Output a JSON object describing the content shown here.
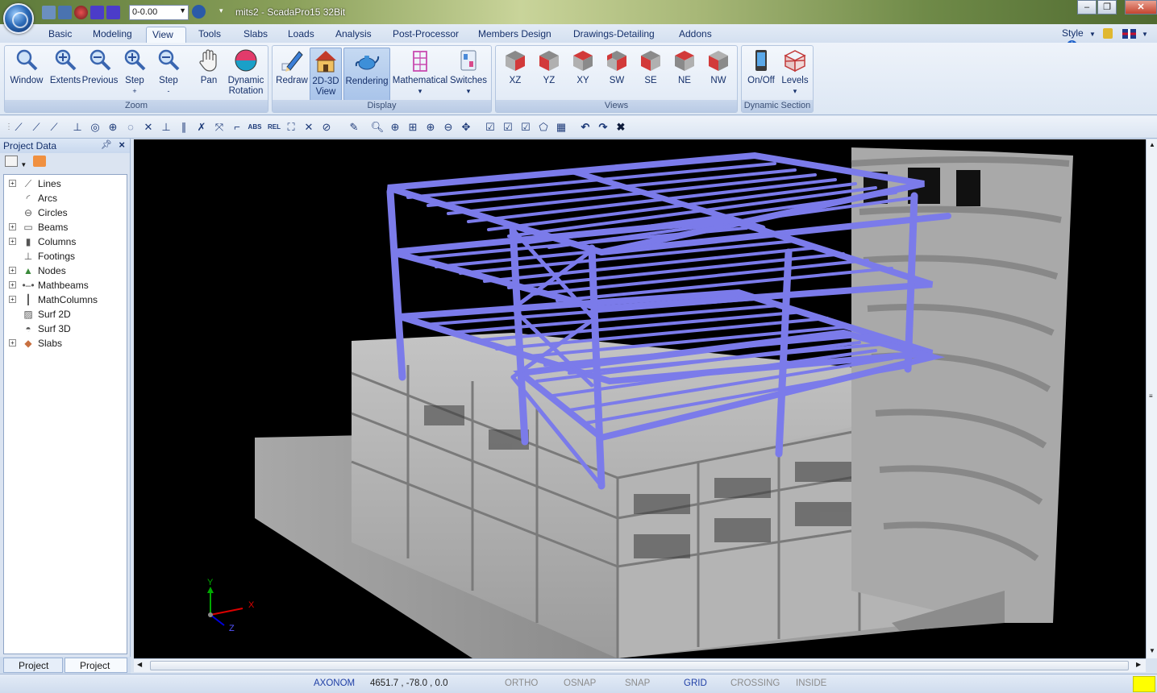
{
  "window": {
    "title": "mits2 - ScadaPro15 32Bit",
    "layer_value": "0-0.00",
    "controls": [
      "minimize-icon",
      "maximize-icon",
      "close-icon"
    ]
  },
  "ribbon_tabs": [
    {
      "label": "Basic",
      "active": false
    },
    {
      "label": "Modeling",
      "active": false
    },
    {
      "label": "View",
      "active": true
    },
    {
      "label": "Tools",
      "active": false
    },
    {
      "label": "Slabs",
      "active": false
    },
    {
      "label": "Loads",
      "active": false
    },
    {
      "label": "Analysis",
      "active": false
    },
    {
      "label": "Post-Processor",
      "active": false
    },
    {
      "label": "Members Design",
      "active": false
    },
    {
      "label": "Drawings-Detailing",
      "active": false
    },
    {
      "label": "Addons",
      "active": false
    }
  ],
  "style_menu": "Style",
  "ribbon": {
    "zoom": {
      "label": "Zoom",
      "buttons": {
        "window": "Window",
        "extents": "Extents",
        "previous": "Previous",
        "step_plus": "Step",
        "step_plus_sub": "+",
        "step_minus": "Step",
        "step_minus_sub": "-",
        "pan": "Pan",
        "rotation_1": "Dynamic",
        "rotation_2": "Rotation"
      }
    },
    "display": {
      "label": "Display",
      "buttons": {
        "redraw": "Redraw",
        "view_1": "2D-3D",
        "view_2": "View",
        "rendering": "Rendering",
        "mathematical": "Mathematical",
        "switches": "Switches",
        "dropdown": "▾"
      }
    },
    "views": {
      "label": "Views",
      "buttons": {
        "xz": "XZ",
        "yz": "YZ",
        "xy": "XY",
        "sw": "SW",
        "se": "SE",
        "ne": "NE",
        "nw": "NW"
      }
    },
    "dynamic_section": {
      "label": "Dynamic Section",
      "buttons": {
        "onoff": "On/Off",
        "levels": "Levels"
      }
    }
  },
  "project_panel": {
    "title": "Project Data",
    "tree": [
      {
        "label": "Lines",
        "icon": "line-icon",
        "expandable": true
      },
      {
        "label": "Arcs",
        "icon": "arc-icon",
        "expandable": false
      },
      {
        "label": "Circles",
        "icon": "circle-icon",
        "expandable": false
      },
      {
        "label": "Beams",
        "icon": "beam-icon",
        "expandable": true
      },
      {
        "label": "Columns",
        "icon": "column-icon",
        "expandable": true
      },
      {
        "label": "Footings",
        "icon": "footing-icon",
        "expandable": false
      },
      {
        "label": "Nodes",
        "icon": "node-icon",
        "expandable": true
      },
      {
        "label": "Mathbeams",
        "icon": "mathbeam-icon",
        "expandable": true
      },
      {
        "label": "MathColumns",
        "icon": "mathcolumn-icon",
        "expandable": true
      },
      {
        "label": "Surf 2D",
        "icon": "surface-2d-icon",
        "expandable": false
      },
      {
        "label": "Surf 3D",
        "icon": "surface-3d-icon",
        "expandable": false
      },
      {
        "label": "Slabs",
        "icon": "slab-icon",
        "expandable": true
      }
    ],
    "tabs": [
      "Project P...",
      "Project D..."
    ]
  },
  "viewport": {
    "axes": {
      "x": "X",
      "y": "Y",
      "z": "Z"
    },
    "colors": {
      "concrete": "#b8b8b8",
      "steel": "#7878e8",
      "background": "#000000"
    }
  },
  "status": {
    "mode": "AXONOM",
    "coordinates": "4651.7 , -78.0 , 0.0",
    "toggles": [
      {
        "label": "ORTHO",
        "on": false
      },
      {
        "label": "OSNAP",
        "on": false
      },
      {
        "label": "SNAP",
        "on": false
      },
      {
        "label": "GRID",
        "on": true
      },
      {
        "label": "CROSSING",
        "on": false
      },
      {
        "label": "INSIDE",
        "on": false
      }
    ]
  }
}
